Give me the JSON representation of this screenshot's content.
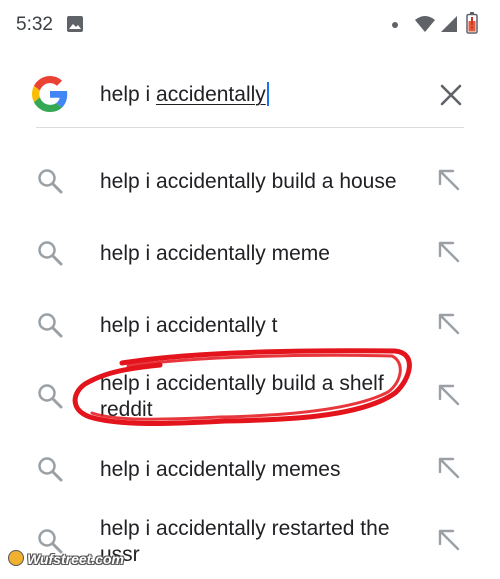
{
  "status_bar": {
    "time": "5:32",
    "icons": [
      "photo-icon",
      "dot-icon",
      "wifi-icon",
      "signal-icon",
      "battery-icon"
    ]
  },
  "search": {
    "query_prefix": "help i ",
    "query_underlined": "accidentally",
    "logo": "google-logo",
    "clear_icon": "close-icon"
  },
  "suggestions": [
    {
      "text": "help i accidentally build a house",
      "icon": "search-icon",
      "action_icon": "arrow-up-left-icon"
    },
    {
      "text": "help i accidentally meme",
      "icon": "search-icon",
      "action_icon": "arrow-up-left-icon"
    },
    {
      "text": "help i accidentally t",
      "icon": "search-icon",
      "action_icon": "arrow-up-left-icon"
    },
    {
      "text": "help i accidentally build a shelf reddit",
      "icon": "search-icon",
      "action_icon": "arrow-up-left-icon"
    },
    {
      "text": "help i accidentally memes",
      "icon": "search-icon",
      "action_icon": "arrow-up-left-icon"
    },
    {
      "text": "help i accidentally restarted the ussr",
      "icon": "search-icon",
      "action_icon": "arrow-up-left-icon"
    }
  ],
  "watermark": "Wufstreet.com",
  "colors": {
    "google_blue": "#4285F4",
    "google_red": "#EA4335",
    "google_yellow": "#FBBC05",
    "google_green": "#34A853",
    "annotation_red": "#e3141b",
    "caret": "#1a73e8"
  }
}
